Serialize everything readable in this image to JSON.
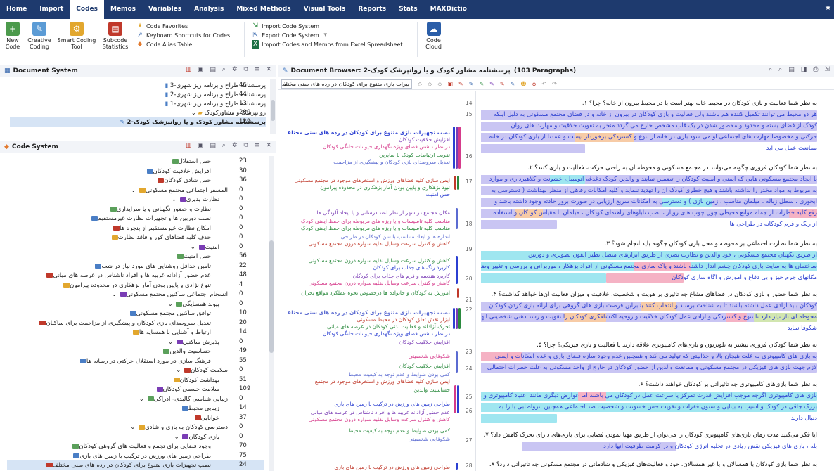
{
  "menubar": {
    "items": [
      "Home",
      "Import",
      "Codes",
      "Memos",
      "Variables",
      "Analysis",
      "Mixed Methods",
      "Visual Tools",
      "Reports",
      "Stats",
      "MAXDictio"
    ],
    "active": "Codes"
  },
  "ribbon": {
    "new_code": "New\nCode",
    "creative_coding": "Creative\nCoding",
    "smart_coding": "Smart Coding\nTool",
    "subcode_stats": "Subcode\nStatistics",
    "code_favorites": "Code Favorites",
    "keyboard_shortcuts": "Keyboard Shortcuts for Codes",
    "code_alias": "Code Alias Table",
    "import_cs": "Import Code System",
    "export_cs": "Export Code System",
    "import_excel": "Import Codes and Memos from Excel Spreadsheet",
    "code_cloud": "Code\nCloud"
  },
  "document_system": {
    "title": "Document System",
    "rows": [
      {
        "label": "پرسشنامه طراح و برنامه ریز شهری-3",
        "count": "46"
      },
      {
        "label": "پرسشنامه طراح و برنامه ریز شهری-2",
        "count": "44"
      },
      {
        "label": "پرسشنامه طراح و برنامه ریز شهری-1",
        "count": "13"
      },
      {
        "label": "روانپزشک و مشاورکودک",
        "count": "200"
      },
      {
        "label": "پرسشنامه مشاور کودک و یا روانپزشک کودک-2",
        "count": "129"
      }
    ]
  },
  "code_system": {
    "title": "Code System",
    "rows": [
      {
        "label": "حس استقلال",
        "count": "23"
      },
      {
        "label": "افزایش خلاقیت کودکان",
        "count": "30"
      },
      {
        "label": "حس شادی کودکان",
        "count": "36"
      },
      {
        "label": "المسفر اجتماعی مجتمع مسکونی",
        "count": "0"
      },
      {
        "label": "نظارت پذیری",
        "count": "0"
      },
      {
        "label": "نظارت و حضور نگهبانی و یا سرایداری",
        "count": "0"
      },
      {
        "label": "نصب دوربین ها و تجهیزات نظارت غیرمستقیم",
        "count": "0"
      },
      {
        "label": "امکان نظارت غیرمستقیم از پنجره ها",
        "count": "0"
      },
      {
        "label": "حذف کلیه فضاهای کور و فاقد نظارت",
        "count": "0"
      },
      {
        "label": "امنیت",
        "count": "0"
      },
      {
        "label": "حس امنیت",
        "count": "56"
      },
      {
        "label": "تامین حداقل روشنایی های مورد نیاز در شب",
        "count": "22"
      },
      {
        "label": "عدم حضور آزادانه غریبه ها و افراد ناشناس در عرصه های میانی",
        "count": "48"
      },
      {
        "label": "تنوع نژادی و پایین بودن آمار بزهکاری در محدوده پیرامون",
        "count": "4"
      },
      {
        "label": "انسجام اجتماعی ساکنین مجتمع مسکونی",
        "count": "0"
      },
      {
        "label": "پیوند همسایگی",
        "count": "0"
      },
      {
        "label": "توافق ساکنین مجتمع مسکونی",
        "count": "10"
      },
      {
        "label": "تعدیل سروصدای بازی کودکان و پیشگیری از مزاحمت برای ساکنان",
        "count": "20"
      },
      {
        "label": "ارتباط و آشنایی با همسایه ها",
        "count": "14"
      },
      {
        "label": "پذیرش ساکنین",
        "count": "0"
      },
      {
        "label": "حساسیت والدین",
        "count": "49"
      },
      {
        "label": "فرهنگ سازی در مورد استقلال حرکتی در رسانه ها",
        "count": "55"
      },
      {
        "label": "سلامت کودکان",
        "count": "0"
      },
      {
        "label": "بهداشت کودکان",
        "count": "51"
      },
      {
        "label": "سلامت جسمی کودکان",
        "count": "109"
      },
      {
        "label": "زیبایی شناسی کالبدی- ادراکی",
        "count": "0"
      },
      {
        "label": "زیبایی محیط",
        "count": "14"
      },
      {
        "label": "خوانایی",
        "count": "37"
      },
      {
        "label": "دسترسی کودکان به بازی و شادی",
        "count": "0"
      },
      {
        "label": "بازی کودکان",
        "count": "0"
      },
      {
        "label": "وجود فضایی برای تجمع و فعالیت های گروهی کودکان",
        "count": "70"
      },
      {
        "label": "طراحی زمین های ورزش در ترکیب با زمین های بازی",
        "count": "75"
      },
      {
        "label": "نصب تجهیزات بازی متنوع برای کودکان در رده های سنی مختلف",
        "count": "24"
      }
    ]
  },
  "browser": {
    "title": "Document Browser: پرسشنامه مشاور کودک و یا روانپزشک کودک-2",
    "paragraphs": "(103 Paragraphs)",
    "code_dropdown": "بیرات بازی متنوع برای کودکان در رده های سنی مختلف",
    "memo_lines": [
      "نصب تجهیزات بازی متنوع برای کودکان در رده های سنی مختلف",
      "افزایش خلاقیت کودکان",
      "در نظر داشتن فضای ویژه نگهداری حیوانات خانگی کودکان",
      "تقویت ارتباطات کودک با سایرین",
      "تعدیل سروصدای بازی کودکان و پیشگیری از مزاحمت",
      "ایمن سازی کلیه فضاهای ورزش و استخرهای موجود در مجتمع مسکونی",
      "نبود بزهکاری و پایین بودن آمار بزهکاری در محدوده پیرامون",
      "حس امنیت",
      "مکان مجتمع در شهر از نظر اعتدادرسانی و یا ایجاد آلودگی ها",
      "مناسب کلیه تاسیسات و یا ریزه های مربوطه برای حفظ ایمنی کودک",
      "مناسب کلیه تاسیسات و یا ریزه های مربوطه برای حفظ ایمنی کودک",
      "اندازه ها و ابعاد متناسب با سن کودکان در طراحی",
      "کاهش و کنترل سرعت وسایل نقلیه سواره درون مجتمع مسکونی",
      "کاهش و کنترل سرعت وسایل نقلیه سواره درون مجتمع مسکونی",
      "کاربرد رنگ های جذاب برای کودکان",
      "کاربرد هندسه و فرم های جذاب برای کودکان",
      "کاهش و کنترل سرعت وسایل نقلیه سواره درون مجتمع مسکونی",
      "آموزش به کودکان و خانواده ها درخصوص نحوه عملکرد مواقع بحران",
      "نصب تجهیزات بازی متنوع برای کودکان در رده های سنی مختلف",
      "ابزار نقش تعلق کودکان در محیط مسکونی",
      "تحرک آزادانه و فعالیت بدنی کودکان در عرصه های میانی",
      "در نظر داشتن فضای ویژه نگهداری حیوانات خانگی کودکان",
      "افزایش خلاقیت کودکان",
      "شکوفایی شخصیتی",
      "افزایش خلاقیت کودکان",
      "کمی بودن ضوابط و عدم توجه به کیفیت محیط",
      "ایمن سازی کلیه فضاهای ورزش و استخرهای موجود در مجتمع",
      "حساسیت والدین",
      "طراحی زمین های ورزش در ترکیب با زمین های بازی",
      "عدم حضور آزادانه غریبه ها و افراد ناشناس در عرصه های میانی",
      "کاهش و کنترل سرعت وسایل نقلیه سواره درون مجتمع مسکونی",
      "کمی بودن ضوابط و عدم توجه به کیفیت محیط",
      "شکوفایی شخصیتی",
      "طراحی زمین های ورزش در ترکیب با زمین های بازی"
    ],
    "para_numbers": [
      "14",
      "15",
      "16",
      "17",
      "18",
      "19",
      "20",
      "21",
      "22",
      "23",
      "24",
      "25",
      "26",
      "27",
      "28"
    ],
    "text_lines": [
      "به نظر شما فعالیت و بازی کودکان در محیط خانه بهتر است یا در محیط بیرون از خانه؟ چرا؟ ۱.",
      "هر دو محیط می توانند تکمیل کننده هم باشند ولی فعالیت و بازی کودکان در بیرون از خانه و در فضای مجتمع مسکونی به دلیل اینکه",
      "کودک از فضای بسته و محدود و محصور شدن در یک قاب مشخص خارج می گردد منجر به تقویت خلاقیت و مهارت های روان",
      "حرکتی و مخصوصا مهارت های اجتماعی او می شود بازی در خانه از تنوع و گستردگی برخوردار نیست و عمدتا از بازی کودکان در خانه",
      "ممانعت عمل می آید",
      "به نظر شما کودکان فروزی چگونه می‌توانند در مجتمع مسکونی و محوطه آن به راحتی حرکت، فعالیت و بازی کنند؟ ۲.",
      "با ایجاد مجتمع مسکونی هایی که ایمنی و امنیت کودکان را تضمین نمایند و والدین کودک دغدغه اتومبیل، خشونت و کلاهبرداری و موارد",
      "به مربوط به مواد مخدر را نداشته باشند و هیچ خطری کودک آن را تهدید ننماید و کلیه امکانات رفاهی از منظر بهداشت ( دسترسی به",
      "آبخوری ، سطل زباله ، مبلمان مناسب ، زمین بازی ) و دسترسی به امکانات سریع ارزیابی در صورت بروز حادثه وجود داشته باشد و",
      "رفع کلیه خطرات از جمله موانع محیطی چون چوب های رویاز ، نصب تابلوهای راهنمای کودکان ، مبلمان با مقیاس کودکان و استفاده",
      "از رنگ و فرم کودکانه در طراحی ها",
      "به نظر شما نظارت اجتماعی بر محوطه و محل بازی کودکان چگونه باید انجام شود؟ ۳.",
      "از طریق نگهبان مجتمع مسکونی ، خود والدین و نظارت بصری از طریق ابزارهای متصل نظیر آیفون تصویری و دوربین",
      "ساختمان ها به سایت بازی کودکان چشم انداز داشته باشند و پاک سازی مجتمع مسکونی از افراد بزهکار ، موربرانی و بررسی و تغییر وضعیت",
      "مکانهای جرم خیز و بی دفاع و آموزش و آگاه سازی کودکان",
      "به نظر شما حضور و بازی کودکان در فضاهای مشاع چه تأثیری بر هویت و شخصیت، خلاقیت و میزان فعالیت آن‌ها خواهد گذاشت؟ ۴.",
      "کودکان باید آزادی عمل داشته باشند تا به شناخت برسند و انتخاب کنند بنابراین فرصت بازی های گروهی برای ارائه بازی کردن کودکان",
      "محوطه ای باز نیاز دارد تا تنوع و گستردگی و آزادی عمل کودکان خلاقیت و روحیه اکتشافگری کودکان را تقویت و رشد ذهنی شخصیتی آنها را",
      "شکوفا نماید",
      "به نظر شما کودکان فروزی بیشتر به تلویزیون و بازی‌های کامپیوتری علاقه دارند یا فعالیت و بازی فیزیکی؟ چرا؟ ۵.",
      "به بازی های کامپیوتری به علت هیجان بالا و جذابیتی که تولید می کند و همچنین عدم وجود سازه فضای بازی و عدم امکانات و ایمنی",
      "لازم جهت بازی های فیزیکی در مجتمع مسکونی و ممانعت والدین از حضور کودکان در خارج از واحد مسکونی به علت خطرات احتمالی",
      "به نظر شما بازی‌های کامپیوتری چه تأثیراتی بر کودکان خواهند داشت؟ ۶.",
      "بازی های کامپیوتری اگرچه موجب افزایش قدرت تمرکز یا سرعت عمل در کودکان می باشند اما عوارض دیگری مانند اعتیاد کامپیوتری و معلول",
      "بزرگ چاقی در کودک و آسیب به بینایی و ستون فقرات و تقویت حس خشونت و شخصیت ضد اجتماعی همچنین انزواطلبی با را به",
      "دنبال دارند",
      "آیا فکر می‌کنید مدت زمان بازی‌های کامپیوتری کودکان را می‌توان از طریق مهیا نمودن فضایی برای بازی‌های دارای تحرک کاهش داد؟ ۷.",
      "بله ، بازی های فیزیکی نقش زیادی در تخلیه انرژی کودکان و در کرمت ظرفیت آنها دارد",
      "به نظر شما بازی کودکان با همسالان و یا غیر همسالان، خود و فعالیت‌های فیزیکی و شادمانی در مجتمع مسکونی چه تأثیراتی دارد؟ ۸."
    ]
  }
}
